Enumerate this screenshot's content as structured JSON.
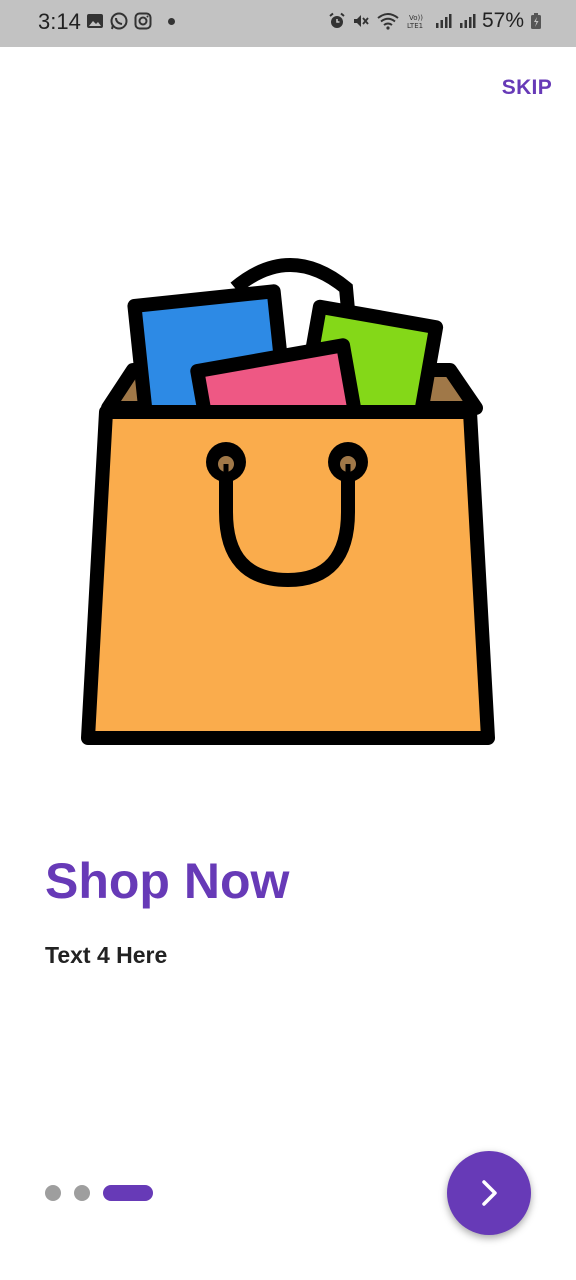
{
  "status_bar": {
    "time": "3:14",
    "battery": "57%",
    "left_icons": [
      "gallery-icon",
      "whatsapp-icon",
      "instagram-icon",
      "notification-dot-icon"
    ],
    "right_icons": [
      "alarm-icon",
      "mute-icon",
      "wifi-icon",
      "volte-icon",
      "signal-icon",
      "signal-icon",
      "battery-icon"
    ]
  },
  "skip_label": "SKIP",
  "onboarding": {
    "title": "Shop Now",
    "subtitle": "Text 4 Here",
    "page_count": 3,
    "current_page": 3
  },
  "colors": {
    "accent": "#673ab7",
    "indicator_inactive": "#9e9e9e",
    "bag": "#faac4c",
    "bag_inner": "#a07848",
    "card_blue": "#2d8ae5",
    "card_pink": "#ee5884",
    "card_green": "#84d818"
  },
  "fab_icon": "chevron-right-icon",
  "illustration": "shopping-bag-icon"
}
